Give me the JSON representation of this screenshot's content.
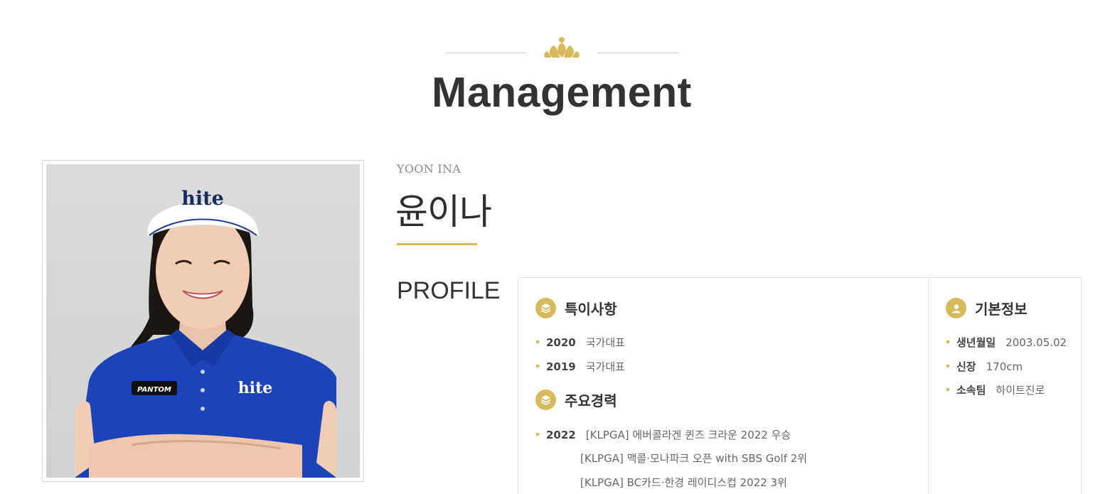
{
  "header": {
    "title": "Management"
  },
  "player": {
    "name_en": "YOON INA",
    "name_ko": "윤이나"
  },
  "profile": {
    "label": "PROFILE",
    "special": {
      "title": "특이사항",
      "items": [
        {
          "year": "2020",
          "text": "국가대표"
        },
        {
          "year": "2019",
          "text": "국가대표"
        }
      ]
    },
    "career": {
      "title": "주요경력",
      "year": "2022",
      "lines": [
        "[KLPGA] 에버콜라겐 퀸즈 크라운 2022 우승",
        "[KLPGA] 맥콜·모나파크 오픈 with SBS Golf 2위",
        "[KLPGA] BC카드·한경 레이디스컵 2022 3위"
      ]
    },
    "basic": {
      "title": "기본정보",
      "items": [
        {
          "key": "생년월일",
          "value": "2003.05.02"
        },
        {
          "key": "신장",
          "value": "170cm"
        },
        {
          "key": "소속팀",
          "value": "하이트진로"
        }
      ]
    }
  },
  "photo": {
    "brand_text": "hite",
    "logo_text": "PANTOM"
  },
  "colors": {
    "accent": "#d8b95c",
    "shirt": "#1c43b8",
    "visor_text": "#1a2a5e"
  },
  "icons": {
    "ornament": "lotus-ornament-icon",
    "special": "layers-icon",
    "career": "layers-icon",
    "basic": "user-icon"
  }
}
